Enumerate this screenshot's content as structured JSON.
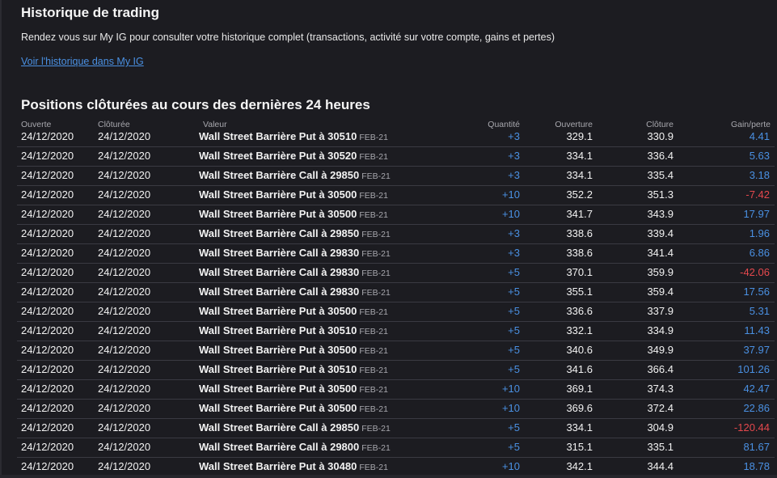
{
  "history": {
    "title": "Historique de trading",
    "description": "Rendez vous sur My IG pour consulter votre historique complet (transactions, activité sur votre compte, gains et pertes)",
    "link": "Voir l'historique dans My IG"
  },
  "positions": {
    "title": "Positions clôturées au cours des dernières 24 heures",
    "headers": {
      "opened": "Ouverte",
      "closed": "Clôturée",
      "value": "Valeur",
      "quantity": "Quantité",
      "open_price": "Ouverture",
      "close_price": "Clôture",
      "pl": "Gain/perte"
    },
    "rows": [
      {
        "opened": "24/12/2020",
        "closed": "24/12/2020",
        "name": "Wall Street Barrière Put à 30510",
        "expiry": "FEB-21",
        "qty": "+3",
        "open": "329.1",
        "close": "330.9",
        "pl": "4.41",
        "sign": "pos"
      },
      {
        "opened": "24/12/2020",
        "closed": "24/12/2020",
        "name": "Wall Street Barrière Put à 30520",
        "expiry": "FEB-21",
        "qty": "+3",
        "open": "334.1",
        "close": "336.4",
        "pl": "5.63",
        "sign": "pos"
      },
      {
        "opened": "24/12/2020",
        "closed": "24/12/2020",
        "name": "Wall Street Barrière Call à 29850",
        "expiry": "FEB-21",
        "qty": "+3",
        "open": "334.1",
        "close": "335.4",
        "pl": "3.18",
        "sign": "pos"
      },
      {
        "opened": "24/12/2020",
        "closed": "24/12/2020",
        "name": "Wall Street Barrière Put à 30500",
        "expiry": "FEB-21",
        "qty": "+10",
        "open": "352.2",
        "close": "351.3",
        "pl": "-7.42",
        "sign": "neg"
      },
      {
        "opened": "24/12/2020",
        "closed": "24/12/2020",
        "name": "Wall Street Barrière Put à 30500",
        "expiry": "FEB-21",
        "qty": "+10",
        "open": "341.7",
        "close": "343.9",
        "pl": "17.97",
        "sign": "pos"
      },
      {
        "opened": "24/12/2020",
        "closed": "24/12/2020",
        "name": "Wall Street Barrière Call à 29850",
        "expiry": "FEB-21",
        "qty": "+3",
        "open": "338.6",
        "close": "339.4",
        "pl": "1.96",
        "sign": "pos"
      },
      {
        "opened": "24/12/2020",
        "closed": "24/12/2020",
        "name": "Wall Street Barrière Call à 29830",
        "expiry": "FEB-21",
        "qty": "+3",
        "open": "338.6",
        "close": "341.4",
        "pl": "6.86",
        "sign": "pos"
      },
      {
        "opened": "24/12/2020",
        "closed": "24/12/2020",
        "name": "Wall Street Barrière Call à 29830",
        "expiry": "FEB-21",
        "qty": "+5",
        "open": "370.1",
        "close": "359.9",
        "pl": "-42.06",
        "sign": "neg"
      },
      {
        "opened": "24/12/2020",
        "closed": "24/12/2020",
        "name": "Wall Street Barrière Call à 29830",
        "expiry": "FEB-21",
        "qty": "+5",
        "open": "355.1",
        "close": "359.4",
        "pl": "17.56",
        "sign": "pos"
      },
      {
        "opened": "24/12/2020",
        "closed": "24/12/2020",
        "name": "Wall Street Barrière Put à 30500",
        "expiry": "FEB-21",
        "qty": "+5",
        "open": "336.6",
        "close": "337.9",
        "pl": "5.31",
        "sign": "pos"
      },
      {
        "opened": "24/12/2020",
        "closed": "24/12/2020",
        "name": "Wall Street Barrière Put à 30510",
        "expiry": "FEB-21",
        "qty": "+5",
        "open": "332.1",
        "close": "334.9",
        "pl": "11.43",
        "sign": "pos"
      },
      {
        "opened": "24/12/2020",
        "closed": "24/12/2020",
        "name": "Wall Street Barrière Put à 30500",
        "expiry": "FEB-21",
        "qty": "+5",
        "open": "340.6",
        "close": "349.9",
        "pl": "37.97",
        "sign": "pos"
      },
      {
        "opened": "24/12/2020",
        "closed": "24/12/2020",
        "name": "Wall Street Barrière Put à 30510",
        "expiry": "FEB-21",
        "qty": "+5",
        "open": "341.6",
        "close": "366.4",
        "pl": "101.26",
        "sign": "pos"
      },
      {
        "opened": "24/12/2020",
        "closed": "24/12/2020",
        "name": "Wall Street Barrière Put à 30500",
        "expiry": "FEB-21",
        "qty": "+10",
        "open": "369.1",
        "close": "374.3",
        "pl": "42.47",
        "sign": "pos"
      },
      {
        "opened": "24/12/2020",
        "closed": "24/12/2020",
        "name": "Wall Street Barrière Put à 30500",
        "expiry": "FEB-21",
        "qty": "+10",
        "open": "369.6",
        "close": "372.4",
        "pl": "22.86",
        "sign": "pos"
      },
      {
        "opened": "24/12/2020",
        "closed": "24/12/2020",
        "name": "Wall Street Barrière Call à 29850",
        "expiry": "FEB-21",
        "qty": "+5",
        "open": "334.1",
        "close": "304.9",
        "pl": "-120.44",
        "sign": "neg"
      },
      {
        "opened": "24/12/2020",
        "closed": "24/12/2020",
        "name": "Wall Street Barrière Call à 29800",
        "expiry": "FEB-21",
        "qty": "+5",
        "open": "315.1",
        "close": "335.1",
        "pl": "81.67",
        "sign": "pos"
      },
      {
        "opened": "24/12/2020",
        "closed": "24/12/2020",
        "name": "Wall Street Barrière Put à 30480",
        "expiry": "FEB-21",
        "qty": "+10",
        "open": "342.1",
        "close": "344.4",
        "pl": "18.78",
        "sign": "pos"
      }
    ]
  },
  "colors": {
    "background": "#1c1c21",
    "positive": "#4a90e2",
    "negative": "#e5484d"
  }
}
